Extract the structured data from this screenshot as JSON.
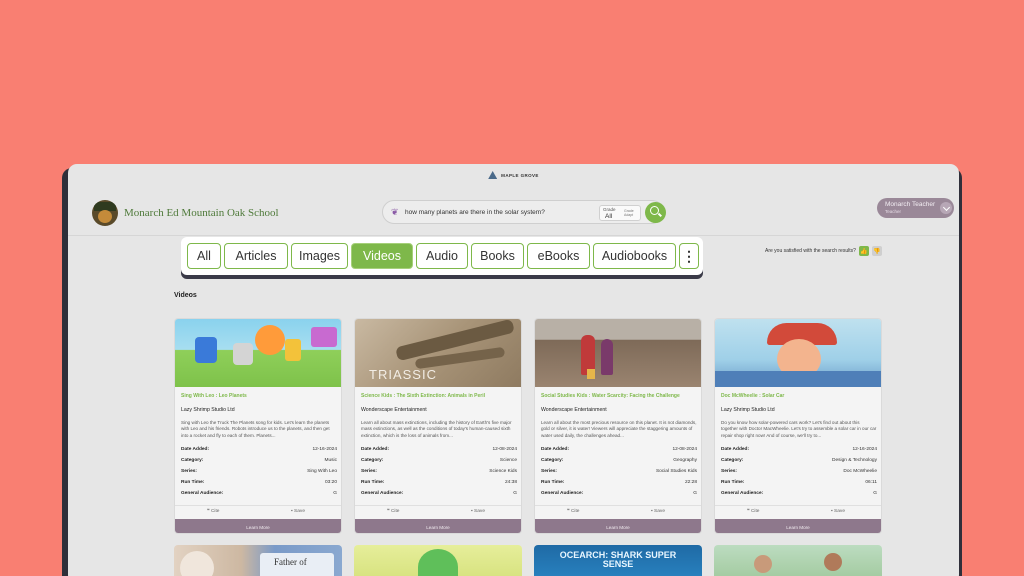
{
  "brand_top": "MAPLE GROVE",
  "school": {
    "name": "Monarch Ed Mountain Oak School"
  },
  "search": {
    "query": "how many planets are there in the solar system?",
    "grade_label": "Grade",
    "grade_value": "All",
    "grade_hint": "Grade Adapt",
    "icon": "search-icon"
  },
  "user": {
    "name": "Monarch Teacher",
    "role": "Teacher"
  },
  "tabs": [
    {
      "label": "All"
    },
    {
      "label": "Articles"
    },
    {
      "label": "Images"
    },
    {
      "label": "Videos",
      "active": true
    },
    {
      "label": "Audio"
    },
    {
      "label": "Books"
    },
    {
      "label": "eBooks"
    },
    {
      "label": "Audiobooks"
    }
  ],
  "feedback": {
    "question": "Are you satisfied with the search results?"
  },
  "section_title": "Videos",
  "labels": {
    "date_added": "Date Added:",
    "category": "Category:",
    "series": "Series:",
    "run_time": "Run Time:",
    "general_audience": "General Audience:",
    "cite": "Cite",
    "save": "Save",
    "learn_more": "Learn More"
  },
  "cards": [
    {
      "title": "Sing With Leo : Leo Planets",
      "publisher": "Lazy Shrimp Studio Ltd",
      "description": "Sing with Leo the Truck The Planets song for kids. Let's learn the planets with Leo and his friends. Robots introduce us to the planets, and then get into a rocket and fly to each of them. Planets...",
      "date_added": "12-16-2024",
      "category": "Music",
      "series": "Sing With Leo",
      "run_time": "03:20",
      "general_audience": "G"
    },
    {
      "title": "Science Kids : The Sixth Extinction: Animals in Peril",
      "publisher": "Wonderscape Entertainment",
      "description": "Learn all about mass extinctions, including the history of Earth's five major mass extinctions, as well as the conditions of today's human-caused sixth extinction, which is the loss of animals from...",
      "date_added": "12-08-2024",
      "category": "Science",
      "series": "Science Kids",
      "run_time": "24:38",
      "general_audience": "G",
      "overlay": "TRIASSIC"
    },
    {
      "title": "Social Studies Kids : Water Scarcity: Facing the Challenge",
      "publisher": "Wonderscape Entertainment",
      "description": "Learn all about the most precious resource on this planet. It is not diamonds, gold or silver, it is water! Viewers will appreciate the staggering amounts of water used daily, the challenges ahead...",
      "date_added": "12-08-2024",
      "category": "Geography",
      "series": "Social Studies Kids",
      "run_time": "22:28",
      "general_audience": "G"
    },
    {
      "title": "Doc McWheelie : Solar Car",
      "publisher": "Lazy Shrimp Studio Ltd",
      "description": "Do you know how solar-powered cars work? Let's find out about this together with Doctor MacWheelie. Let's try to assemble a solar car in our car repair shop right now! And of course, we'll try to...",
      "date_added": "12-16-2024",
      "category": "Design & Technology",
      "series": "Doc McWheelie",
      "run_time": "06:11",
      "general_audience": "G"
    }
  ],
  "bottom_cards": [
    {
      "overlay": "Father of"
    },
    {
      "overlay": ""
    },
    {
      "overlay": "OCEARCH: SHARK SUPER SENSE"
    },
    {
      "overlay": ""
    }
  ],
  "colors": {
    "accent": "#7eb84a",
    "learn_more": "#8e788c",
    "page_bg": "#f97f72"
  }
}
